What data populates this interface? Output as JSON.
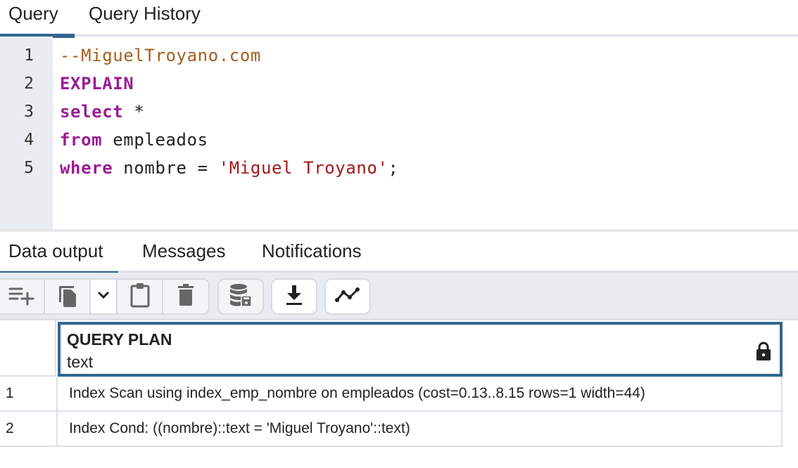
{
  "top_tabs": [
    {
      "label": "Query",
      "active": true
    },
    {
      "label": "Query History",
      "active": false
    }
  ],
  "editor": {
    "lines": [
      {
        "number": "1",
        "tokens": [
          {
            "type": "comment",
            "text": "--MiguelTroyano.com"
          }
        ]
      },
      {
        "number": "2",
        "tokens": [
          {
            "type": "keyword",
            "text": "EXPLAIN"
          }
        ]
      },
      {
        "number": "3",
        "tokens": [
          {
            "type": "keyword",
            "text": "select"
          },
          {
            "type": "plain",
            "text": " *"
          }
        ]
      },
      {
        "number": "4",
        "tokens": [
          {
            "type": "keyword",
            "text": "from"
          },
          {
            "type": "plain",
            "text": " empleados"
          }
        ]
      },
      {
        "number": "5",
        "tokens": [
          {
            "type": "keyword",
            "text": "where"
          },
          {
            "type": "plain",
            "text": " nombre = "
          },
          {
            "type": "string",
            "text": "'Miguel Troyano'"
          },
          {
            "type": "plain",
            "text": ";"
          }
        ]
      }
    ]
  },
  "output_tabs": [
    {
      "label": "Data output",
      "active": true
    },
    {
      "label": "Messages",
      "active": false
    },
    {
      "label": "Notifications",
      "active": false
    }
  ],
  "toolbar": {
    "buttons": [
      {
        "name": "add-row",
        "icon": "add-row-icon"
      },
      {
        "name": "copy",
        "icon": "copy-icon"
      },
      {
        "name": "copy-options",
        "icon": "chevron-down-icon"
      },
      {
        "name": "paste",
        "icon": "clipboard-icon"
      },
      {
        "name": "delete",
        "icon": "trash-icon"
      },
      {
        "name": "save-data",
        "icon": "database-save-icon"
      },
      {
        "name": "download",
        "icon": "download-icon"
      },
      {
        "name": "graph-visualiser",
        "icon": "line-graph-icon"
      }
    ]
  },
  "grid": {
    "columns": [
      {
        "name": "QUERY PLAN",
        "type": "text",
        "icon": "lock-icon"
      }
    ],
    "rows": [
      {
        "number": "1",
        "value": "Index Scan using index_emp_nombre on empleados (cost=0.13..8.15 rows=1 width=44)"
      },
      {
        "number": "2",
        "value": "Index Cond: ((nombre)::text = 'Miguel Troyano'::text)"
      }
    ]
  },
  "colors": {
    "accent": "#326690",
    "comment": "#a55e1c",
    "keyword": "#9a1d94",
    "string": "#a31818"
  }
}
